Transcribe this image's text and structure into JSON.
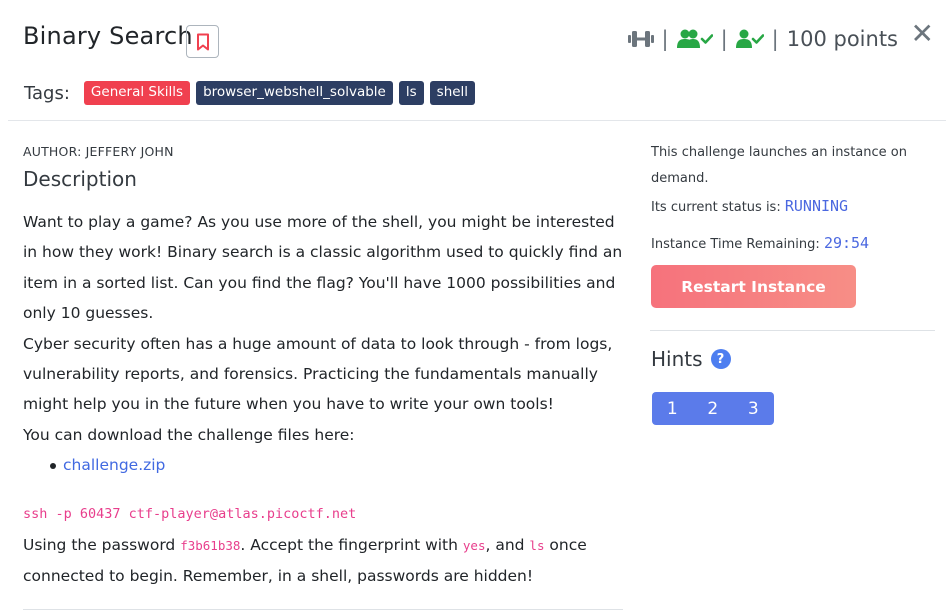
{
  "challenge": {
    "title": "Binary Search",
    "points_text": "100 points",
    "tags_label": "Tags:",
    "tags": [
      "General Skills",
      "browser_webshell_solvable",
      "ls",
      "shell"
    ],
    "author": "AUTHOR: JEFFERY JOHN",
    "description_heading": "Description",
    "paragraphs": [
      "Want to play a game? As you use more of the shell, you might be interested in how they work! Binary search is a classic algorithm used to quickly find an item in a sorted list. Can you find the flag? You'll have 1000 possibilities and only 10 guesses.",
      "Cyber security often has a huge amount of data to look through - from logs, vulnerability reports, and forensics. Practicing the fundamentals manually might help you in the future when you have to write your own tools!",
      "You can download the challenge files here:"
    ],
    "download_link": "challenge.zip",
    "ssh_command": "ssh -p 60437 ctf-player@atlas.picoctf.net",
    "instructions": {
      "part1": "Using the password ",
      "password": "f3b61b38",
      "part2": ". Accept the fingerprint with ",
      "yes": "yes",
      "part3": ", and ",
      "ls": "ls",
      "part4": " once connected to begin. Remember, in a shell, passwords are hidden!"
    }
  },
  "instance": {
    "launch_text": "This challenge launches an instance on demand.",
    "status_label": "Its current status is:",
    "status_value": "RUNNING",
    "time_label": "Instance Time Remaining:",
    "time_value": "29:54",
    "restart_label": "Restart Instance"
  },
  "hints": {
    "heading": "Hints",
    "items": [
      "1",
      "2",
      "3"
    ]
  },
  "colors": {
    "accent": "#4d7ef0",
    "tag_dark": "#2d3e63",
    "tag_red": "#f0404f",
    "code_pink": "#e83e8c",
    "restart": "#f6727c"
  },
  "icons": [
    "bookmark-icon",
    "dumbbell-icon",
    "users-check-icon",
    "user-check-icon",
    "close-icon",
    "question-circle-icon"
  ]
}
